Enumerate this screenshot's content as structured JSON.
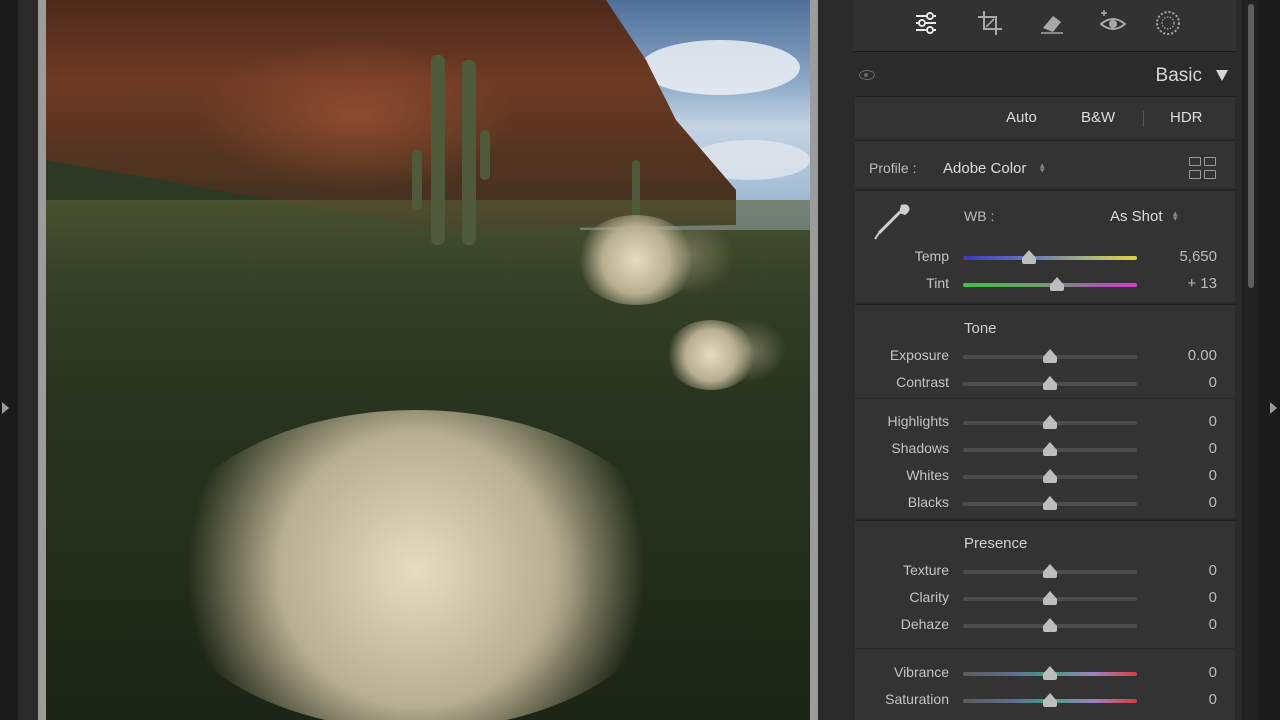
{
  "panel": {
    "title": "Basic"
  },
  "treatment": {
    "auto": "Auto",
    "bw": "B&W",
    "hdr": "HDR"
  },
  "profile": {
    "label": "Profile :",
    "value": "Adobe Color"
  },
  "wb": {
    "label": "WB :",
    "value": "As Shot",
    "temp": {
      "label": "Temp",
      "value": "5,650",
      "position": 0.38
    },
    "tint": {
      "label": "Tint",
      "value": "+ 13",
      "position": 0.54
    }
  },
  "tone": {
    "title": "Tone",
    "sliders": [
      {
        "label": "Exposure",
        "value": "0.00",
        "position": 0.5
      },
      {
        "label": "Contrast",
        "value": "0",
        "position": 0.5
      },
      {
        "label": "Highlights",
        "value": "0",
        "position": 0.5
      },
      {
        "label": "Shadows",
        "value": "0",
        "position": 0.5
      },
      {
        "label": "Whites",
        "value": "0",
        "position": 0.5
      },
      {
        "label": "Blacks",
        "value": "0",
        "position": 0.5
      }
    ]
  },
  "presence": {
    "title": "Presence",
    "sliders": [
      {
        "label": "Texture",
        "value": "0",
        "position": 0.5
      },
      {
        "label": "Clarity",
        "value": "0",
        "position": 0.5
      },
      {
        "label": "Dehaze",
        "value": "0",
        "position": 0.5
      },
      {
        "label": "Vibrance",
        "value": "0",
        "position": 0.5
      },
      {
        "label": "Saturation",
        "value": "0",
        "position": 0.5
      }
    ]
  },
  "tools": [
    "edit-sliders-icon",
    "crop-icon",
    "healing-eraser-icon",
    "red-eye-icon",
    "masking-icon"
  ]
}
